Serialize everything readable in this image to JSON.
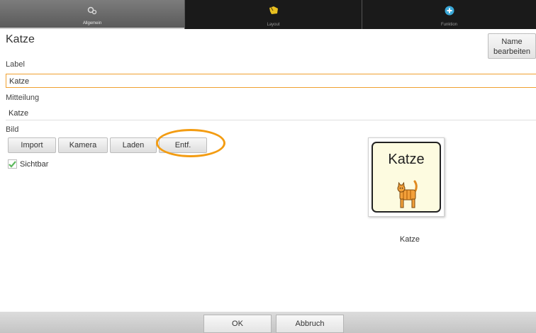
{
  "tabs": [
    {
      "label": "Allgemein",
      "icon": "settings-icon",
      "active": true
    },
    {
      "label": "Layout",
      "icon": "layout-icon",
      "active": false
    },
    {
      "label": "Funktion",
      "icon": "plus-circle-icon",
      "active": false
    }
  ],
  "header": {
    "title": "Katze",
    "rename_button": "Name\nbearbeiten"
  },
  "fields": {
    "label_caption": "Label",
    "label_value": "Katze",
    "message_caption": "Mitteilung",
    "message_value": "Katze"
  },
  "image_section": {
    "caption": "Bild",
    "buttons": [
      "Import",
      "Kamera",
      "Laden",
      "Entf."
    ]
  },
  "visible": {
    "label": "Sichtbar",
    "checked": true
  },
  "preview": {
    "symbol_text": "Katze",
    "caption": "Katze"
  },
  "footer": {
    "ok": "OK",
    "cancel": "Abbruch"
  },
  "colors": {
    "accent": "#f39c12",
    "check": "#5cb85c"
  }
}
